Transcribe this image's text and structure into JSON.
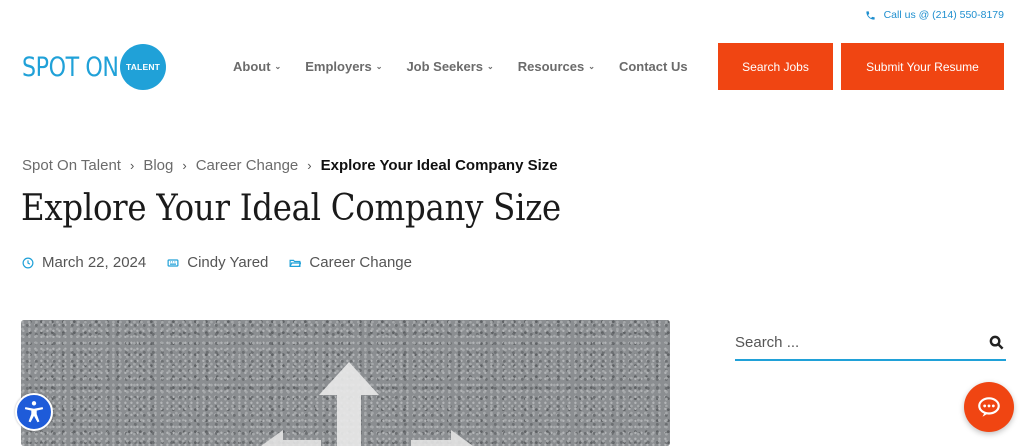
{
  "topbar": {
    "phone_text": "Call us @ (214) 550-8179",
    "phone_icon": "phone-icon"
  },
  "logo": {
    "word": "SPOT ON",
    "badge": "TALENT"
  },
  "nav": {
    "items": [
      {
        "label": "About",
        "has_dropdown": true
      },
      {
        "label": "Employers",
        "has_dropdown": true
      },
      {
        "label": "Job Seekers",
        "has_dropdown": true
      },
      {
        "label": "Resources",
        "has_dropdown": true
      },
      {
        "label": "Contact Us",
        "has_dropdown": false
      }
    ],
    "chevron_glyph": "⌄"
  },
  "buttons": {
    "search_jobs": "Search Jobs",
    "submit_resume": "Submit Your Resume"
  },
  "breadcrumb": {
    "items": [
      "Spot On Talent",
      "Blog",
      "Career Change"
    ],
    "current": "Explore Your Ideal Company Size",
    "separator": "›"
  },
  "post": {
    "title": "Explore Your Ideal Company Size",
    "date": "March 22, 2024",
    "author": "Cindy Yared",
    "category": "Career Change"
  },
  "sidebar": {
    "search_placeholder": "Search ..."
  },
  "colors": {
    "accent": "#20a1d8",
    "cta": "#f04512",
    "access": "#1e5bd9"
  }
}
